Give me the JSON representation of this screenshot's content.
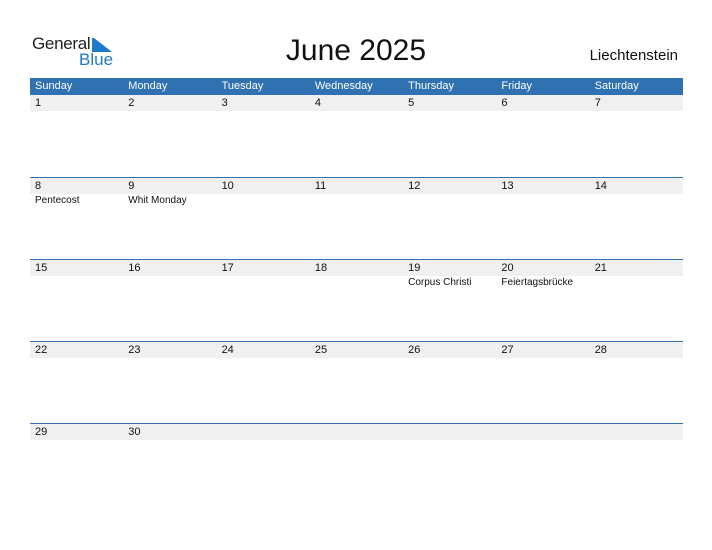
{
  "logo": {
    "part1": "General",
    "part2": "Blue"
  },
  "title": "June 2025",
  "country": "Liechtenstein",
  "weekdays": [
    "Sunday",
    "Monday",
    "Tuesday",
    "Wednesday",
    "Thursday",
    "Friday",
    "Saturday"
  ],
  "weeks": [
    {
      "days": [
        "1",
        "2",
        "3",
        "4",
        "5",
        "6",
        "7"
      ],
      "events": [
        "",
        "",
        "",
        "",
        "",
        "",
        ""
      ]
    },
    {
      "days": [
        "8",
        "9",
        "10",
        "11",
        "12",
        "13",
        "14"
      ],
      "events": [
        "Pentecost",
        "Whit Monday",
        "",
        "",
        "",
        "",
        ""
      ]
    },
    {
      "days": [
        "15",
        "16",
        "17",
        "18",
        "19",
        "20",
        "21"
      ],
      "events": [
        "",
        "",
        "",
        "",
        "Corpus Christi",
        "Feiertagsbrücke",
        ""
      ]
    },
    {
      "days": [
        "22",
        "23",
        "24",
        "25",
        "26",
        "27",
        "28"
      ],
      "events": [
        "",
        "",
        "",
        "",
        "",
        "",
        ""
      ]
    },
    {
      "days": [
        "29",
        "30",
        "",
        "",
        "",
        "",
        ""
      ],
      "events": [
        "",
        "",
        "",
        "",
        "",
        "",
        ""
      ]
    }
  ],
  "colors": {
    "header": "#2f71b1",
    "brand": "#1e7bc8",
    "daterow": "#f0f0f0"
  }
}
